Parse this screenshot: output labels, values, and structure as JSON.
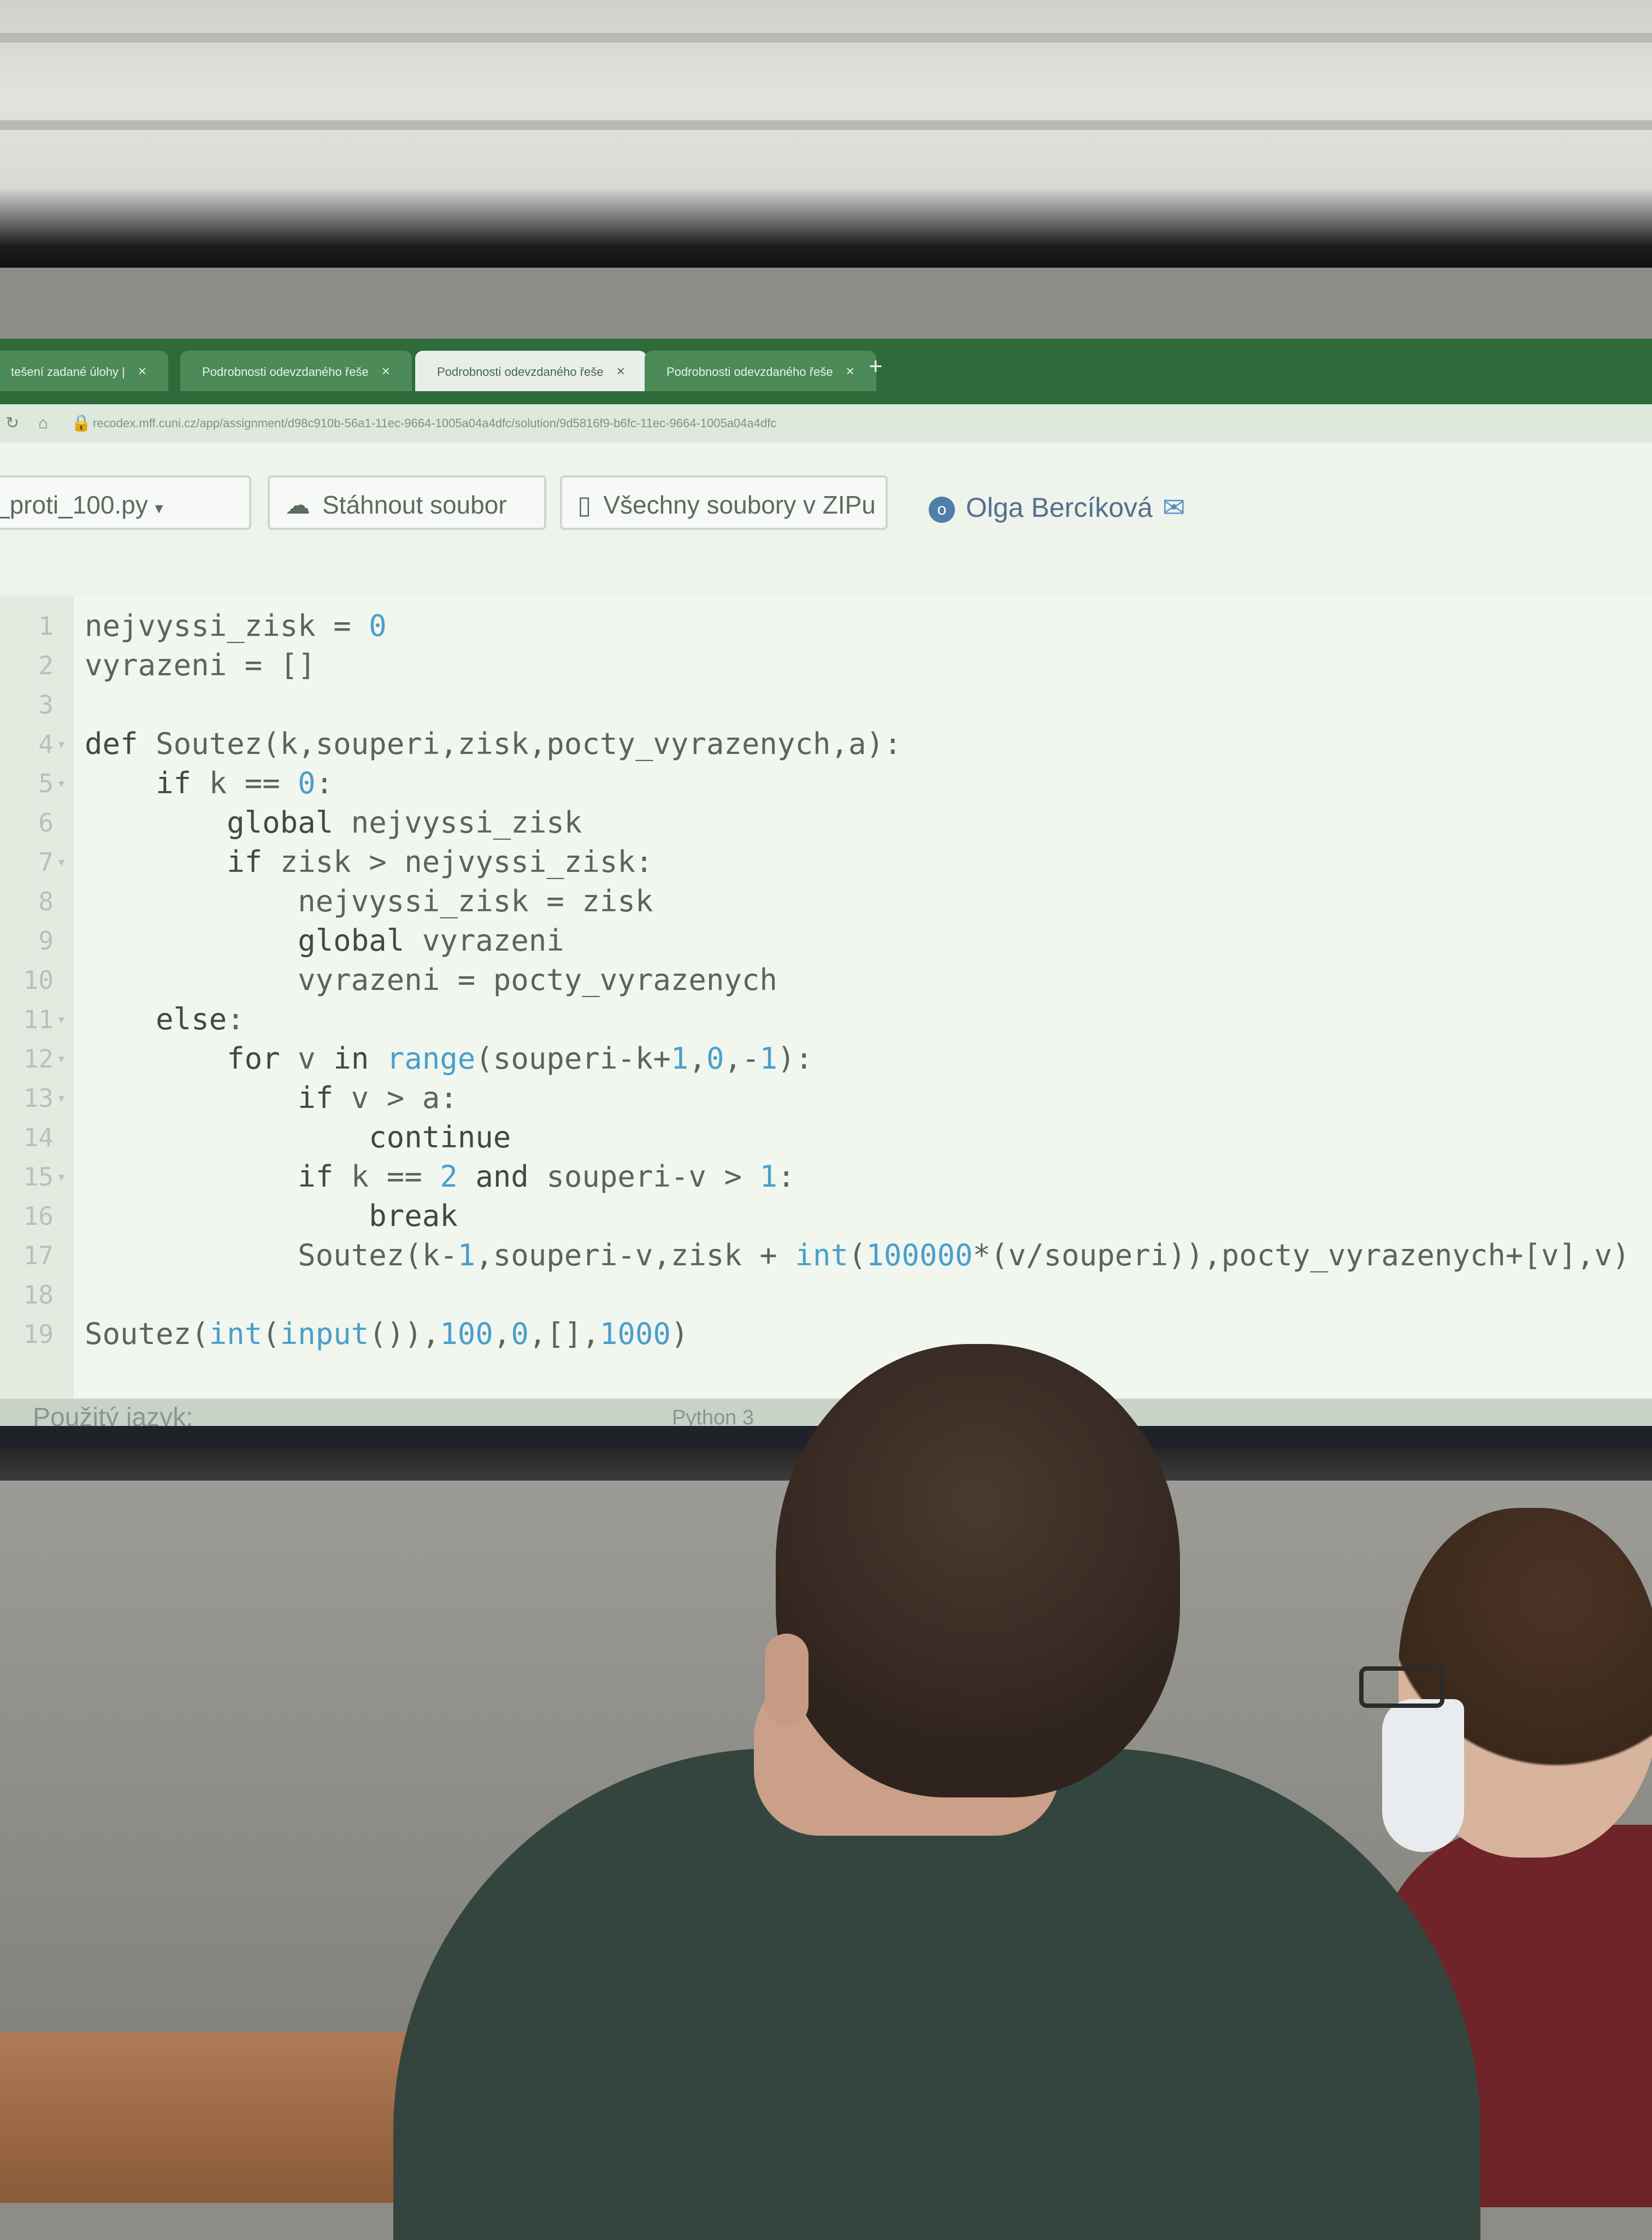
{
  "browser": {
    "tabs": [
      {
        "label": "tešení zadané úlohy |",
        "active": false
      },
      {
        "label": "Podrobnosti odevzdaného řeše",
        "active": false
      },
      {
        "label": "Podrobnosti odevzdaného řeše",
        "active": true
      },
      {
        "label": "Podrobnosti odevzdaného řeše",
        "active": false
      }
    ],
    "url": "recodex.mff.cuni.cz/app/assignment/d98c910b-56a1-11ec-9664-1005a04a4dfc/solution/9d5816f9-b6fc-11ec-9664-1005a04a4dfc"
  },
  "toolbar": {
    "file_select": "_proti_100.py",
    "download_button": "Stáhnout soubor",
    "zip_button": "Všechny soubory v ZIPu",
    "user_name": "Olga Bercíková"
  },
  "code": [
    {
      "n": "1",
      "fold": false,
      "text": "nejvyssi_zisk = 0"
    },
    {
      "n": "2",
      "fold": false,
      "text": "vyrazeni = []"
    },
    {
      "n": "3",
      "fold": false,
      "text": ""
    },
    {
      "n": "4",
      "fold": true,
      "text": "def Soutez(k,souperi,zisk,pocty_vyrazenych,a):"
    },
    {
      "n": "5",
      "fold": true,
      "text": "    if k == 0:"
    },
    {
      "n": "6",
      "fold": false,
      "text": "        global nejvyssi_zisk"
    },
    {
      "n": "7",
      "fold": true,
      "text": "        if zisk > nejvyssi_zisk:"
    },
    {
      "n": "8",
      "fold": false,
      "text": "            nejvyssi_zisk = zisk"
    },
    {
      "n": "9",
      "fold": false,
      "text": "            global vyrazeni"
    },
    {
      "n": "10",
      "fold": false,
      "text": "            vyrazeni = pocty_vyrazenych"
    },
    {
      "n": "11",
      "fold": true,
      "text": "    else:"
    },
    {
      "n": "12",
      "fold": true,
      "text": "        for v in range(souperi-k+1,0,-1):"
    },
    {
      "n": "13",
      "fold": true,
      "text": "            if v > a:"
    },
    {
      "n": "14",
      "fold": false,
      "text": "                continue"
    },
    {
      "n": "15",
      "fold": true,
      "text": "            if k == 2 and souperi-v > 1:"
    },
    {
      "n": "16",
      "fold": false,
      "text": "                break"
    },
    {
      "n": "17",
      "fold": false,
      "text": "            Soutez(k-1,souperi-v,zisk + int(100000*(v/souperi)),pocty_vyrazenych+[v],v)"
    },
    {
      "n": "18",
      "fold": false,
      "text": ""
    },
    {
      "n": "19",
      "fold": false,
      "text": "Soutez(int(input()),100,0,[],1000)"
    }
  ],
  "status": {
    "language_label": "Použitý jazyk:",
    "language_value": "Python 3"
  },
  "colors": {
    "header_green": "#2e6b3a",
    "number_blue": "#4aa0c9",
    "editor_bg": "#f1f6ef"
  }
}
